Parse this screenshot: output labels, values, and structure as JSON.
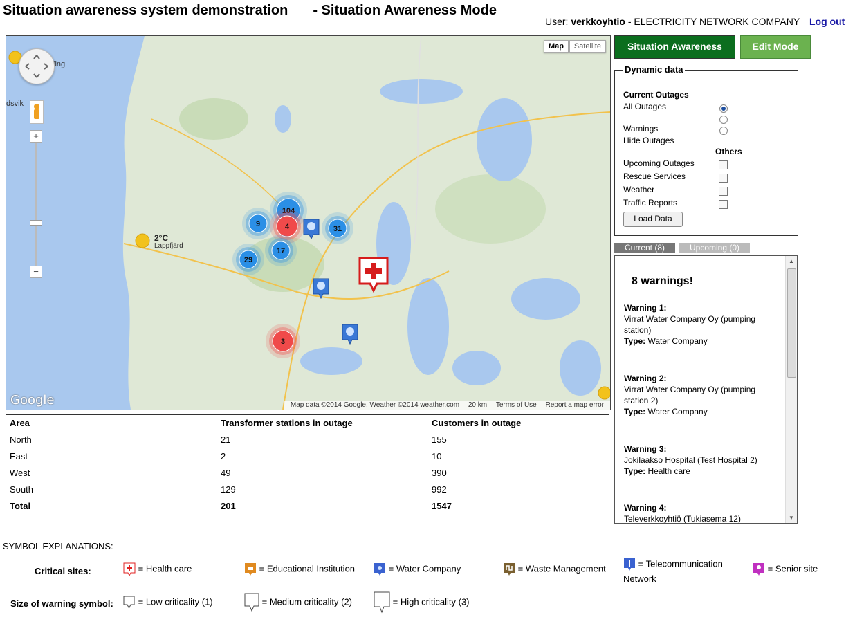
{
  "header": {
    "title": "Situation awareness system demonstration",
    "mode": "- Situation Awareness Mode",
    "user_prefix": "User:",
    "user": "verkkoyhtio",
    "company": "- ELECTRICITY NETWORK COMPANY",
    "logout": "Log out"
  },
  "map": {
    "type_buttons": [
      "Map",
      "Satellite"
    ],
    "place_labels": [
      "ling",
      "dsvik",
      "Lappfjärd"
    ],
    "weather": {
      "temp": "2°C",
      "city": "Lappfjärd"
    },
    "clusters": [
      {
        "count": "104",
        "color": "#2b8fe6"
      },
      {
        "count": "9",
        "color": "#2b8fe6"
      },
      {
        "count": "4",
        "color": "#f04a4a"
      },
      {
        "count": "31",
        "color": "#2b8fe6"
      },
      {
        "count": "17",
        "color": "#2b8fe6"
      },
      {
        "count": "29",
        "color": "#2b8fe6"
      },
      {
        "count": "3",
        "color": "#f04a4a"
      }
    ],
    "logo": "Google",
    "footer": [
      "Map data ©2014 Google, Weather ©2014 weather.com",
      "20 km",
      "Terms of Use",
      "Report a map error"
    ]
  },
  "outage_table": {
    "headers": [
      "Area",
      "Transformer stations in outage",
      "Customers in outage"
    ],
    "rows": [
      [
        "North",
        "21",
        "155"
      ],
      [
        "East",
        "2",
        "10"
      ],
      [
        "West",
        "49",
        "390"
      ],
      [
        "South",
        "129",
        "992"
      ]
    ],
    "total": [
      "Total",
      "201",
      "1547"
    ]
  },
  "modes": {
    "situation": "Situation Awareness",
    "edit": "Edit Mode"
  },
  "dynamic": {
    "legend": "Dynamic data",
    "current_outages": "Current Outages",
    "all_outages": "All Outages",
    "warnings": "Warnings",
    "hide_outages": "Hide Outages",
    "others": "Others",
    "upcoming": "Upcoming Outages",
    "rescue": "Rescue Services",
    "weather": "Weather",
    "traffic": "Traffic Reports",
    "load": "Load Data"
  },
  "tabs": {
    "current": "Current (8)",
    "upcoming": "Upcoming (0)"
  },
  "warnings": {
    "title": "8 warnings!",
    "items": [
      {
        "heading": "Warning 1:",
        "name": "Virrat Water Company Oy (pumping station)",
        "type_label": "Type:",
        "type": "Water Company"
      },
      {
        "heading": "Warning 2:",
        "name": "Virrat Water Company Oy (pumping station 2)",
        "type_label": "Type:",
        "type": "Water Company"
      },
      {
        "heading": "Warning 3:",
        "name": "Jokilaakso Hospital (Test Hospital 2)",
        "type_label": "Type:",
        "type": "Health care"
      },
      {
        "heading": "Warning 4:",
        "name": "Televerkkoyhtiö (Tukiasema 12)",
        "type_label": "",
        "type": ""
      }
    ]
  },
  "symbols": {
    "title": "SYMBOL EXPLANATIONS:",
    "critical_label": "Critical sites:",
    "critical": [
      {
        "text": "= Health care",
        "color": "#e02020",
        "icon": "health-care-icon"
      },
      {
        "text": "= Educational Institution",
        "color": "#e08a20",
        "icon": "education-icon"
      },
      {
        "text": "= Water Company",
        "color": "#3a62d0",
        "icon": "water-icon"
      },
      {
        "text": "= Waste Management",
        "color": "#7a6030",
        "icon": "waste-icon"
      },
      {
        "text": "= Telecommunication",
        "text2": "Network",
        "color": "#3a62d0",
        "icon": "telecom-icon"
      },
      {
        "text": "= Senior site",
        "color": "#c030c0",
        "icon": "senior-icon"
      }
    ],
    "size_label": "Size of warning symbol:",
    "sizes": [
      {
        "text": "= Low criticality (1)"
      },
      {
        "text": "= Medium criticality (2)"
      },
      {
        "text": "= High criticality (3)"
      }
    ]
  }
}
